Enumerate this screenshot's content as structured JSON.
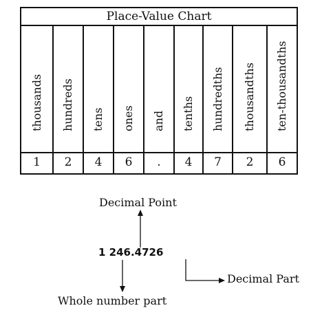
{
  "table": {
    "title": "Place-Value Chart",
    "columns": [
      {
        "header": "thousands",
        "digit": "1"
      },
      {
        "header": "hundreds",
        "digit": "2"
      },
      {
        "header": "tens",
        "digit": "4"
      },
      {
        "header": "ones",
        "digit": "6"
      },
      {
        "header": "and",
        "digit": "."
      },
      {
        "header": "tenths",
        "digit": "4"
      },
      {
        "header": "hundredths",
        "digit": "7"
      },
      {
        "header": "thousandths",
        "digit": "2"
      },
      {
        "header": "ten-thousandths",
        "digit": "6"
      }
    ]
  },
  "diagram": {
    "decimal_point_label": "Decimal Point",
    "number": "1 246.4726",
    "decimal_part_label": "Decimal Part",
    "whole_part_label": "Whole number part"
  }
}
